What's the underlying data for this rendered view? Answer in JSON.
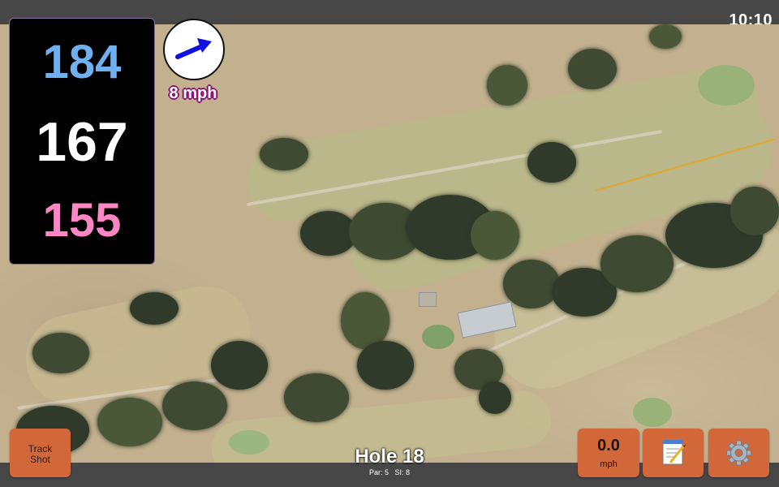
{
  "status_bar": {
    "time": "10:10"
  },
  "distances": {
    "back": "184",
    "middle": "167",
    "front": "155"
  },
  "wind": {
    "speed": "8 mph",
    "icon": "wind-arrow-icon"
  },
  "hole": {
    "title": "Hole 18",
    "par": "Par: 5",
    "si": "SI: 8"
  },
  "buttons": {
    "track_shot": {
      "line1": "Track",
      "line2": "Shot"
    },
    "speed": {
      "value": "0.0",
      "unit": "mph"
    },
    "notes": {
      "icon": "notepad-icon"
    },
    "settings": {
      "icon": "gear-icon"
    }
  },
  "colors": {
    "back_distance": "#6fb0ef",
    "middle_distance": "#ffffff",
    "front_distance": "#ff86c4",
    "button": "#d2683a",
    "wind_arrow": "#1010e0"
  }
}
